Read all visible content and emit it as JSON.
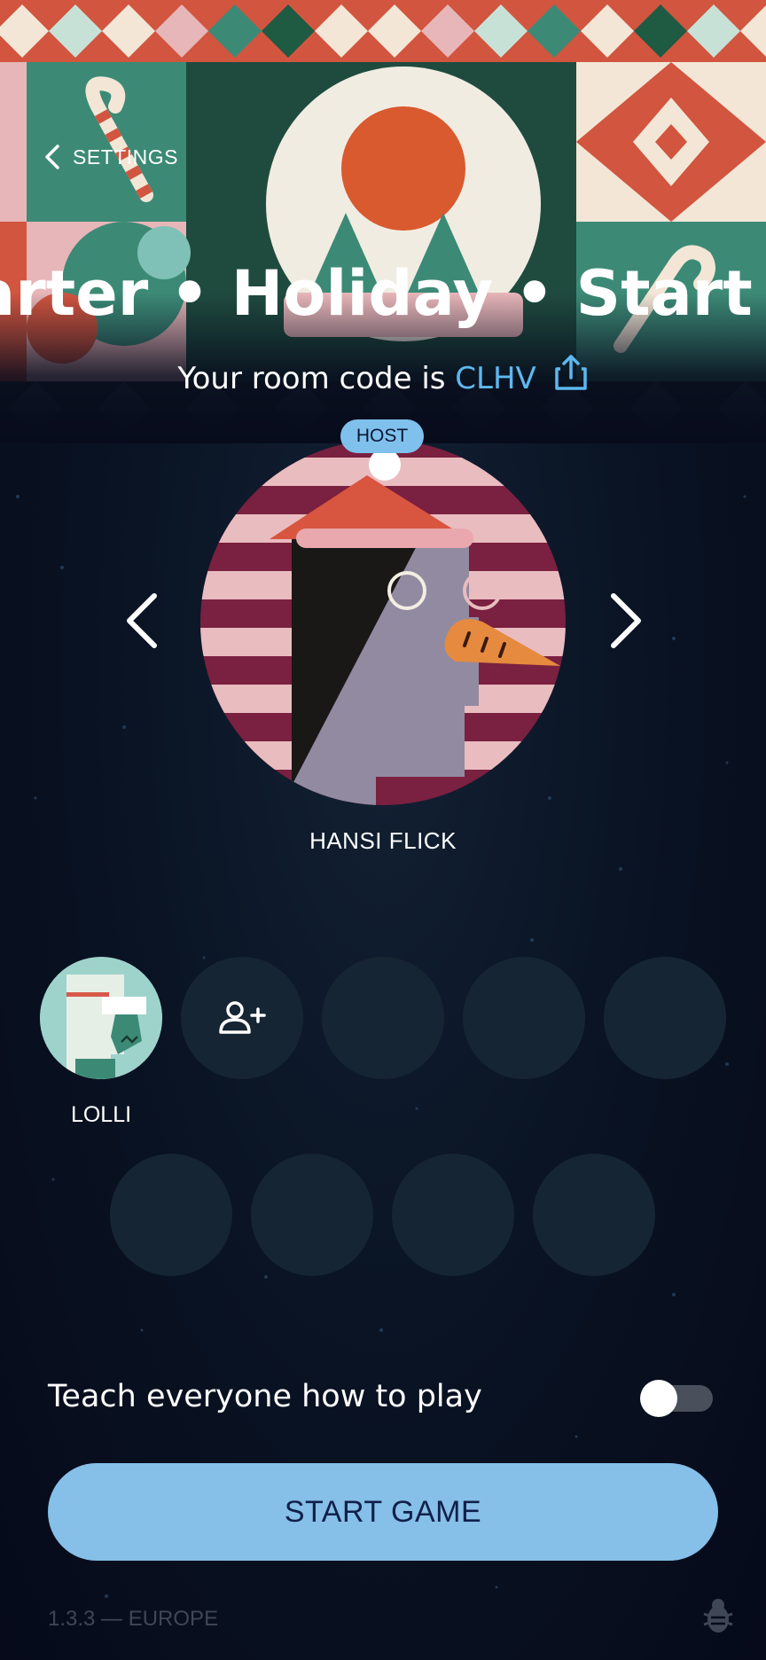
{
  "header": {
    "back_label": "SETTINGS",
    "marquee_text": "arter  •  Holiday  •  Start",
    "room_prefix": "Your room code is ",
    "room_code": "CLHV"
  },
  "host": {
    "badge": "HOST",
    "name": "HANSI FLICK"
  },
  "players": [
    {
      "name": "LOLLI"
    }
  ],
  "options": {
    "teach_label": "Teach everyone how to play",
    "teach_enabled": false
  },
  "actions": {
    "start_label": "START GAME"
  },
  "footer": {
    "version": "1.3.3 — EUROPE"
  },
  "colors": {
    "accent": "#5db8f0",
    "start_button": "#86bfe8",
    "background": "#070b1c"
  }
}
